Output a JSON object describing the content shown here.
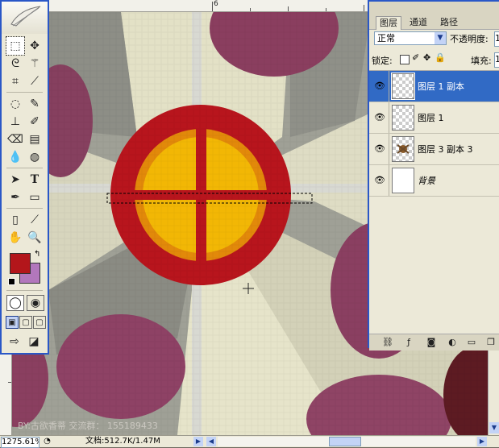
{
  "colors": {
    "foreground": "#b3161b",
    "background": "#b277bc",
    "selected_layer": "#316ac5",
    "palette_border": "#2a57c7"
  },
  "ruler": {
    "top_label": "6"
  },
  "tools": [
    "rectangular-marquee-icon",
    "move-icon",
    "lasso-icon",
    "magic-wand-icon",
    "crop-icon",
    "slice-icon",
    "healing-brush-icon",
    "brush-icon",
    "clone-stamp-icon",
    "history-brush-icon",
    "eraser-icon",
    "gradient-icon",
    "blur-icon",
    "dodge-icon",
    "path-selection-icon",
    "type-icon",
    "pen-icon",
    "shape-icon",
    "notes-icon",
    "eyedropper-icon",
    "hand-icon",
    "zoom-icon"
  ],
  "layers_panel": {
    "tabs": [
      "图层",
      "通道",
      "路径"
    ],
    "blend_mode": "正常",
    "opacity_label": "不透明度:",
    "opacity_value": "1",
    "lock_label": "锁定:",
    "fill_label": "填充:",
    "fill_value": "1",
    "layers": [
      {
        "name": "图层 1 副本",
        "active": true
      },
      {
        "name": "图层 1",
        "active": false
      },
      {
        "name": "图层 3 副本 3",
        "active": false
      },
      {
        "name": "背景",
        "active": false
      }
    ]
  },
  "watermark": "BY:古欲香蒂 交流群：  155189433",
  "status_bar": {
    "zoom": "1275.61%",
    "doc_label": "文档:512.7K/1.47M"
  }
}
